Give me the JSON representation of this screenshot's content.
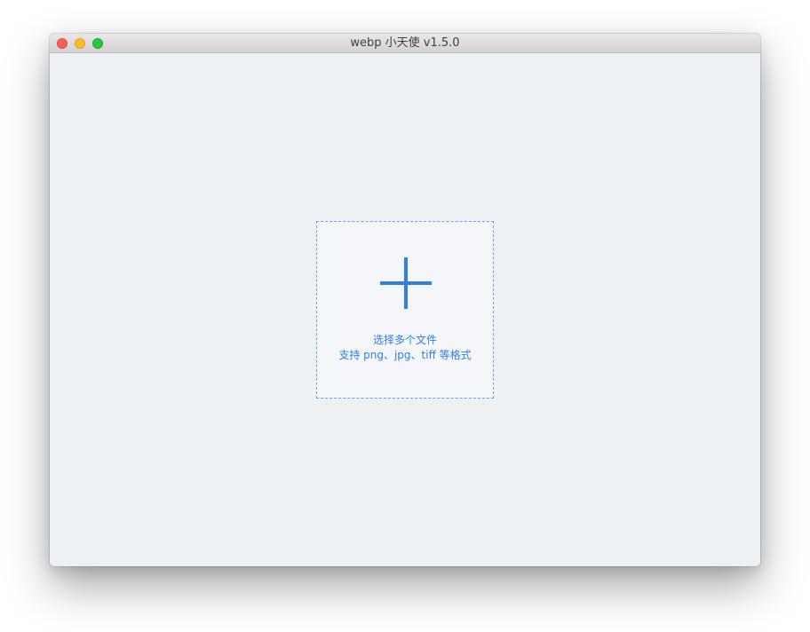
{
  "window": {
    "title": "webp 小天使 v1.5.0"
  },
  "controls": {
    "close": "close",
    "minimize": "minimize",
    "zoom": "zoom"
  },
  "dropzone": {
    "icon": "plus-icon",
    "line1": "选择多个文件",
    "line2": "支持 png、jpg、tiff 等格式"
  },
  "colors": {
    "accent": "#2f80e2",
    "dropzone_border": "#5aa4f0",
    "background": "#eef1f3",
    "traffic_close": "#fc5f57",
    "traffic_minimize": "#fdbc2e",
    "traffic_zoom": "#27c840"
  }
}
